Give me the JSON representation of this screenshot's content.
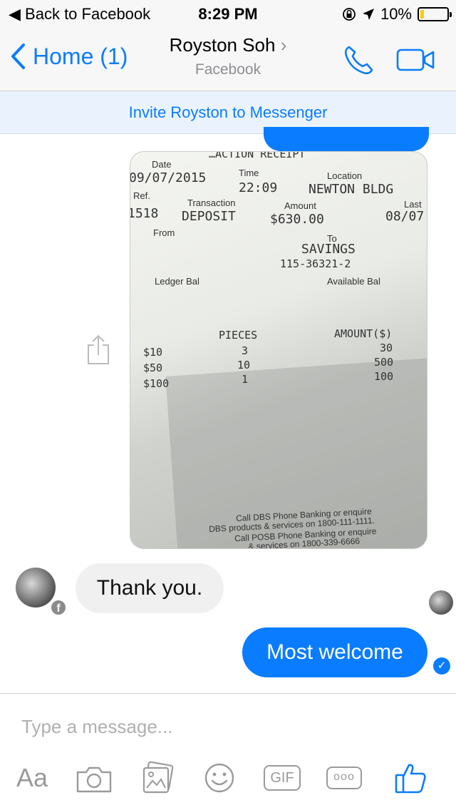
{
  "status_bar": {
    "back_label": "Back to Facebook",
    "time": "8:29 PM",
    "battery": "10%",
    "battery_level": 0.1
  },
  "nav": {
    "home_label": "Home (1)",
    "contact_name": "Royston Soh",
    "contact_sub": "Facebook"
  },
  "invite_banner": "Invite Royston to Messenger",
  "receipt": {
    "header": "…ACTION RECEIPT",
    "date_label": "Date",
    "date": "09/07/2015",
    "time_label": "Time",
    "time": "22:09",
    "location_label": "Location",
    "location": "NEWTON BLDG",
    "ref_label": "Ref.",
    "ref": "1518",
    "transaction_label": "Transaction",
    "transaction": "DEPOSIT",
    "amount_label": "Amount",
    "amount": "$630.00",
    "last_label": "Last",
    "last": "08/07",
    "from_label": "From",
    "to_label": "To",
    "to_account_type": "SAVINGS",
    "to_account_no": "115-36321-2",
    "ledger_label": "Ledger Bal",
    "available_label": "Available Bal",
    "pieces_header": "PIECES",
    "amount_header": "AMOUNT($)",
    "rows": [
      {
        "denom": "$10",
        "pieces": "3",
        "amount": "30"
      },
      {
        "denom": "$50",
        "pieces": "10",
        "amount": "500"
      },
      {
        "denom": "$100",
        "pieces": "1",
        "amount": "100"
      }
    ],
    "footer": [
      "Call DBS Phone Banking or enquire",
      "DBS products & services on 1800-111-1111.",
      "Call POSB Phone Banking or enquire",
      "… & services on 1800-339-6666"
    ]
  },
  "messages": {
    "incoming": "Thank you.",
    "outgoing": "Most welcome",
    "seen_mark": "✓",
    "fb_badge": "f"
  },
  "composer": {
    "placeholder": "Type a message...",
    "tools": {
      "aa": "Aa",
      "gif": "GIF",
      "more": "ooo"
    }
  },
  "icons": [
    "share-icon",
    "phone-icon",
    "video-icon",
    "camera-icon",
    "photo-icon",
    "emoji-icon",
    "like-icon",
    "location-arrow-icon",
    "rotation-lock-icon"
  ],
  "colors": {
    "accent": "#0a7cff",
    "bubble_in": "#f0f0f0",
    "battery_low": "#ffcc00"
  }
}
